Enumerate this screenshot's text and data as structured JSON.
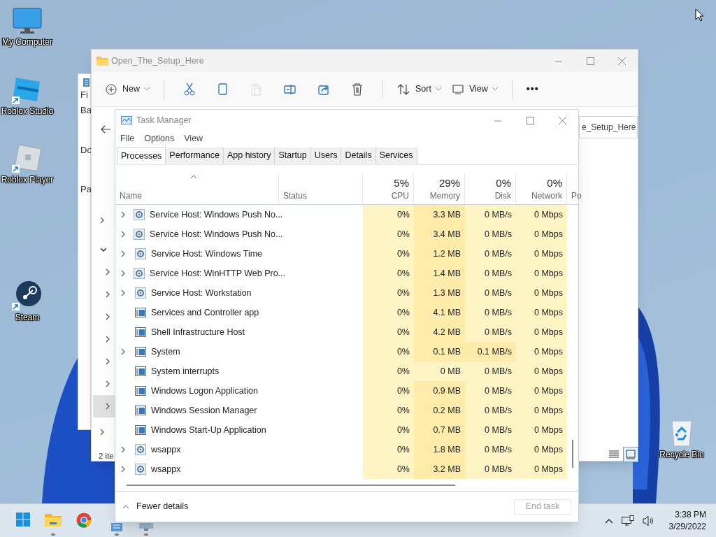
{
  "desktop_icons": [
    {
      "label": "My Computer",
      "kind": "monitor",
      "shortcut": false
    },
    {
      "label": "Roblox Studio",
      "kind": "studio",
      "shortcut": true
    },
    {
      "label": "Roblox Player",
      "kind": "player",
      "shortcut": true
    },
    {
      "label": "Steam",
      "kind": "steam",
      "shortcut": true
    },
    {
      "label": "Recycle Bin",
      "kind": "recycle",
      "shortcut": false
    }
  ],
  "back_window": {
    "lines": [
      "Fi",
      "Ba",
      "Do",
      "Pa"
    ]
  },
  "explorer": {
    "title": "Open_The_Setup_Here",
    "toolbar": [
      {
        "kind": "new",
        "label": "New",
        "disabled": false
      },
      {
        "kind": "cut",
        "disabled": false
      },
      {
        "kind": "copy",
        "disabled": false
      },
      {
        "kind": "paste",
        "disabled": true
      },
      {
        "kind": "rename",
        "disabled": false
      },
      {
        "kind": "share",
        "disabled": false
      },
      {
        "kind": "delete",
        "disabled": false
      },
      {
        "kind": "sort",
        "label": "Sort",
        "disabled": false
      },
      {
        "kind": "view",
        "label": "View",
        "disabled": false
      },
      {
        "kind": "more",
        "label": "•••",
        "disabled": false
      }
    ],
    "address": "e_Setup_Here",
    "nav": [
      {
        "expanded": false,
        "selected": false
      },
      {
        "expanded": true,
        "selected": false,
        "children": [
          {
            "selected": false
          },
          {
            "selected": false
          },
          {
            "selected": false
          },
          {
            "selected": false
          },
          {
            "selected": false
          },
          {
            "selected": false
          },
          {
            "selected": true
          }
        ]
      },
      {
        "expanded": false,
        "selected": false
      }
    ],
    "status": "2 ite",
    "view_buttons": [
      {
        "kind": "details",
        "selected": false
      },
      {
        "kind": "tiles",
        "selected": true
      }
    ]
  },
  "task_manager": {
    "title": "Task Manager",
    "menu": [
      "File",
      "Options",
      "View"
    ],
    "tabs": [
      {
        "label": "Processes",
        "selected": true
      },
      {
        "label": "Performance",
        "selected": false
      },
      {
        "label": "App history",
        "selected": false
      },
      {
        "label": "Startup",
        "selected": false
      },
      {
        "label": "Users",
        "selected": false
      },
      {
        "label": "Details",
        "selected": false
      },
      {
        "label": "Services",
        "selected": false
      }
    ],
    "columns": [
      {
        "label": "Name"
      },
      {
        "label": "Status"
      },
      {
        "label": "CPU",
        "usage": "5%"
      },
      {
        "label": "Memory",
        "usage": "29%"
      },
      {
        "label": "Disk",
        "usage": "0%"
      },
      {
        "label": "Network",
        "usage": "0%"
      },
      {
        "label": "Po"
      }
    ],
    "rows": [
      {
        "expandable": true,
        "kind": "service",
        "name": "Service Host: Windows Push No...",
        "values": [
          {
            "text": "0%",
            "color": "#fff4c4"
          },
          {
            "text": "3.3 MB",
            "color": "#ffecab"
          },
          {
            "text": "0 MB/s",
            "color": "#fff4c4"
          },
          {
            "text": "0 Mbps",
            "color": "#fff4c4"
          }
        ]
      },
      {
        "expandable": true,
        "kind": "service",
        "name": "Service Host: Windows Push No...",
        "values": [
          {
            "text": "0%",
            "color": "#fff4c4"
          },
          {
            "text": "3.4 MB",
            "color": "#ffecab"
          },
          {
            "text": "0 MB/s",
            "color": "#fff4c4"
          },
          {
            "text": "0 Mbps",
            "color": "#fff4c4"
          }
        ]
      },
      {
        "expandable": true,
        "kind": "service",
        "name": "Service Host: Windows Time",
        "values": [
          {
            "text": "0%",
            "color": "#fff4c4"
          },
          {
            "text": "1.2 MB",
            "color": "#ffecab"
          },
          {
            "text": "0 MB/s",
            "color": "#fff4c4"
          },
          {
            "text": "0 Mbps",
            "color": "#fff4c4"
          }
        ]
      },
      {
        "expandable": true,
        "kind": "service",
        "name": "Service Host: WinHTTP Web Pro...",
        "values": [
          {
            "text": "0%",
            "color": "#fff4c4"
          },
          {
            "text": "1.4 MB",
            "color": "#ffecab"
          },
          {
            "text": "0 MB/s",
            "color": "#fff4c4"
          },
          {
            "text": "0 Mbps",
            "color": "#fff4c4"
          }
        ]
      },
      {
        "expandable": true,
        "kind": "service",
        "name": "Service Host: Workstation",
        "values": [
          {
            "text": "0%",
            "color": "#fff4c4"
          },
          {
            "text": "1.3 MB",
            "color": "#ffecab"
          },
          {
            "text": "0 MB/s",
            "color": "#fff4c4"
          },
          {
            "text": "0 Mbps",
            "color": "#fff4c4"
          }
        ]
      },
      {
        "expandable": false,
        "kind": "process",
        "name": "Services and Controller app",
        "values": [
          {
            "text": "0%",
            "color": "#fff4c4"
          },
          {
            "text": "4.1 MB",
            "color": "#ffecab"
          },
          {
            "text": "0 MB/s",
            "color": "#fff4c4"
          },
          {
            "text": "0 Mbps",
            "color": "#fff4c4"
          }
        ]
      },
      {
        "expandable": false,
        "kind": "process",
        "name": "Shell Infrastructure Host",
        "values": [
          {
            "text": "0%",
            "color": "#fff4c4"
          },
          {
            "text": "4.2 MB",
            "color": "#ffecab"
          },
          {
            "text": "0 MB/s",
            "color": "#fff4c4"
          },
          {
            "text": "0 Mbps",
            "color": "#fff4c4"
          }
        ]
      },
      {
        "expandable": true,
        "kind": "process",
        "name": "System",
        "values": [
          {
            "text": "0%",
            "color": "#fff4c4"
          },
          {
            "text": "0.1 MB",
            "color": "#ffecab"
          },
          {
            "text": "0.1 MB/s",
            "color": "#ffecab"
          },
          {
            "text": "0 Mbps",
            "color": "#fff4c4"
          }
        ]
      },
      {
        "expandable": false,
        "kind": "process",
        "name": "System interrupts",
        "values": [
          {
            "text": "0%",
            "color": "#fff4c4"
          },
          {
            "text": "0 MB",
            "color": "#fff4c4"
          },
          {
            "text": "0 MB/s",
            "color": "#fff4c4"
          },
          {
            "text": "0 Mbps",
            "color": "#fff4c4"
          }
        ]
      },
      {
        "expandable": false,
        "kind": "process",
        "name": "Windows Logon Application",
        "values": [
          {
            "text": "0%",
            "color": "#fff4c4"
          },
          {
            "text": "0.9 MB",
            "color": "#ffecab"
          },
          {
            "text": "0 MB/s",
            "color": "#fff4c4"
          },
          {
            "text": "0 Mbps",
            "color": "#fff4c4"
          }
        ]
      },
      {
        "expandable": false,
        "kind": "process",
        "name": "Windows Session Manager",
        "values": [
          {
            "text": "0%",
            "color": "#fff4c4"
          },
          {
            "text": "0.2 MB",
            "color": "#ffecab"
          },
          {
            "text": "0 MB/s",
            "color": "#fff4c4"
          },
          {
            "text": "0 Mbps",
            "color": "#fff4c4"
          }
        ]
      },
      {
        "expandable": false,
        "kind": "process",
        "name": "Windows Start-Up Application",
        "values": [
          {
            "text": "0%",
            "color": "#fff4c4"
          },
          {
            "text": "0.7 MB",
            "color": "#ffecab"
          },
          {
            "text": "0 MB/s",
            "color": "#fff4c4"
          },
          {
            "text": "0 Mbps",
            "color": "#fff4c4"
          }
        ]
      },
      {
        "expandable": true,
        "kind": "service",
        "name": "wsappx",
        "values": [
          {
            "text": "0%",
            "color": "#fff4c4"
          },
          {
            "text": "1.8 MB",
            "color": "#ffecab"
          },
          {
            "text": "0 MB/s",
            "color": "#fff4c4"
          },
          {
            "text": "0 Mbps",
            "color": "#fff4c4"
          }
        ]
      },
      {
        "expandable": true,
        "kind": "service",
        "name": "wsappx",
        "values": [
          {
            "text": "0%",
            "color": "#fff4c4"
          },
          {
            "text": "3.2 MB",
            "color": "#ffecab"
          },
          {
            "text": "0 MB/s",
            "color": "#fff4c4"
          },
          {
            "text": "0 Mbps",
            "color": "#fff4c4"
          }
        ]
      }
    ],
    "footer": {
      "toggle": "Fewer details",
      "end_task": {
        "label": "End task",
        "disabled": true
      }
    }
  },
  "taskbar": {
    "apps": [
      {
        "kind": "start",
        "running": false
      },
      {
        "kind": "folder",
        "running": true
      },
      {
        "kind": "chrome",
        "running": false
      },
      {
        "kind": "notepad",
        "running": true
      },
      {
        "kind": "taskmgr",
        "running": true
      }
    ],
    "time": "3:38 PM",
    "date": "3/29/2022"
  }
}
